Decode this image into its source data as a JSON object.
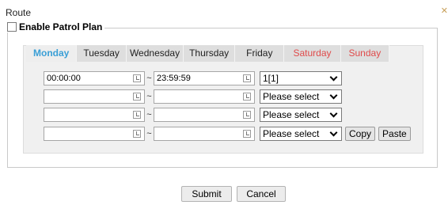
{
  "window": {
    "title": "Route",
    "close_icon": "close-icon"
  },
  "patrol": {
    "enable_label": "Enable Patrol Plan",
    "enabled": false
  },
  "tabs": [
    {
      "label": "Monday",
      "active": true
    },
    {
      "label": "Tuesday"
    },
    {
      "label": "Wednesday"
    },
    {
      "label": "Thursday"
    },
    {
      "label": "Friday"
    },
    {
      "label": "Saturday",
      "weekend": true
    },
    {
      "label": "Sunday",
      "weekend": true
    }
  ],
  "rows": [
    {
      "start": "00:00:00",
      "end": "23:59:59",
      "route": "1[1]"
    },
    {
      "start": "",
      "end": "",
      "route": "Please select"
    },
    {
      "start": "",
      "end": "",
      "route": "Please select"
    },
    {
      "start": "",
      "end": "",
      "route": "Please select"
    }
  ],
  "row_actions": {
    "copy": "Copy",
    "paste": "Paste"
  },
  "separator": "~",
  "footer": {
    "submit": "Submit",
    "cancel": "Cancel"
  },
  "colors": {
    "active_tab": "#3a9fd6",
    "weekend_tab": "#e04b4b",
    "panel": "#f0f0f0"
  }
}
